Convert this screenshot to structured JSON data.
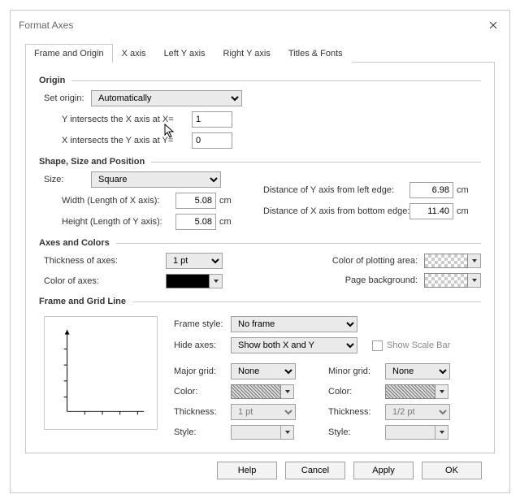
{
  "window": {
    "title": "Format Axes"
  },
  "tabs": [
    "Frame and Origin",
    "X axis",
    "Left Y axis",
    "Right Y axis",
    "Titles & Fonts"
  ],
  "activeTab": 0,
  "sections": {
    "origin": {
      "title": "Origin",
      "setOriginLabel": "Set origin:",
      "setOriginValue": "Automatically",
      "yIntersectsLabel": "Y intersects the X axis at X=",
      "yIntersectsValue": "1",
      "xIntersectsLabel": "X intersects the Y axis at Y=",
      "xIntersectsValue": "0"
    },
    "shape": {
      "title": "Shape, Size and Position",
      "sizeLabel": "Size:",
      "sizeValue": "Square",
      "widthLabel": "Width (Length of X axis):",
      "widthValue": "5.08",
      "heightLabel": "Height (Length of Y axis):",
      "heightValue": "5.08",
      "unitCm": "cm",
      "distYLabel": "Distance of Y axis from left edge:",
      "distYValue": "6.98",
      "distXLabel": "Distance of X axis from bottom edge:",
      "distXValue": "11.40"
    },
    "axes": {
      "title": "Axes and Colors",
      "thicknessLabel": "Thickness of axes:",
      "thicknessValue": "1 pt",
      "colorAxesLabel": "Color of axes:",
      "plotAreaLabel": "Color of plotting area:",
      "pageBgLabel": "Page background:"
    },
    "frame": {
      "title": "Frame and Grid Line",
      "frameStyleLabel": "Frame style:",
      "frameStyleValue": "No frame",
      "hideAxesLabel": "Hide axes:",
      "hideAxesValue": "Show both X and Y",
      "showScaleBarLabel": "Show Scale Bar",
      "majorGridLabel": "Major grid:",
      "minorGridLabel": "Minor grid:",
      "noneValue": "None",
      "colorLabel": "Color:",
      "thickLabel": "Thickness:",
      "styleLabel": "Style:",
      "majorThickness": "1 pt",
      "minorThickness": "1/2 pt"
    }
  },
  "buttons": {
    "help": "Help",
    "cancel": "Cancel",
    "apply": "Apply",
    "ok": "OK"
  }
}
